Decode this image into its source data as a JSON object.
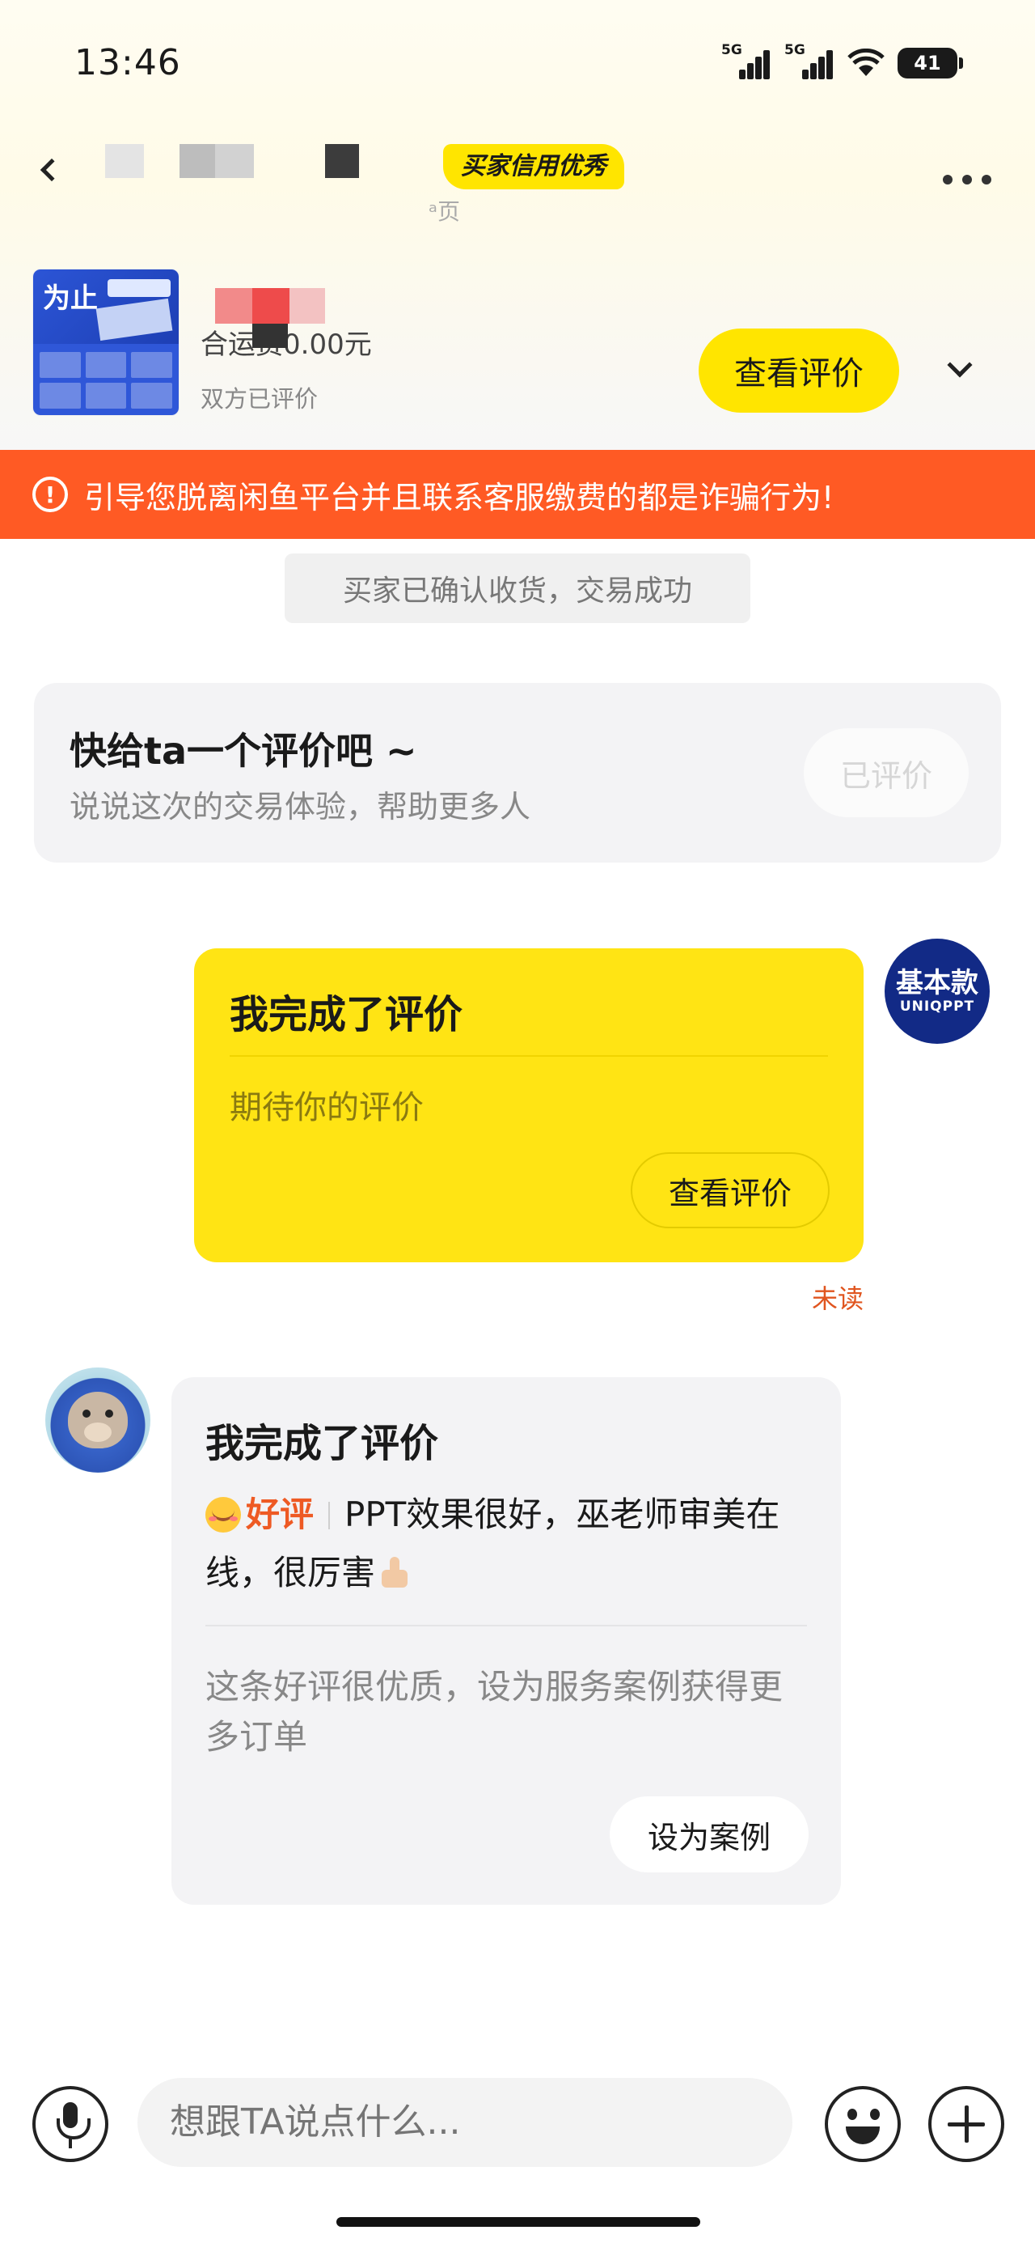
{
  "status_bar": {
    "time": "13:46",
    "signal1_label": "5G",
    "signal2_label": "5G",
    "battery": "41"
  },
  "header": {
    "credit_badge": "买家信用优秀",
    "subtitle_fragment": "ᵃ页"
  },
  "product": {
    "price_text": "合运费0.00元",
    "status": "双方已评价",
    "view_review_button": "查看评价",
    "thumb_title": "为止"
  },
  "warning": {
    "icon": "!",
    "text": "引导您脱离闲鱼平台并且联系客服缴费的都是诈骗行为!"
  },
  "system_message": "买家已确认收货，交易成功",
  "review_prompt": {
    "title": "快给ta一个评价吧 ~",
    "subtitle": "说说这次的交易体验，帮助更多人",
    "button": "已评价"
  },
  "outgoing": {
    "avatar_line1": "基本款",
    "avatar_line2": "UNIQPPT",
    "title": "我完成了评价",
    "subtitle": "期待你的评价",
    "button": "查看评价",
    "read_status": "未读"
  },
  "incoming": {
    "title": "我完成了评价",
    "rating_label": "好评",
    "review_text": "PPT效果很好，巫老师审美在线，很厉害",
    "promo_text": "这条好评很优质，设为服务案例获得更多订单",
    "button": "设为案例"
  },
  "input_bar": {
    "placeholder": "想跟TA说点什么..."
  },
  "colors": {
    "brand_yellow": "#ffe500",
    "warning_orange": "#ff5a24",
    "good_review_orange": "#ee5a24",
    "unread_orange": "#e0551f"
  },
  "icons": [
    "back-icon",
    "more-icon",
    "chevron-down-icon",
    "warning-icon",
    "mic-icon",
    "emoji-icon",
    "plus-icon"
  ]
}
